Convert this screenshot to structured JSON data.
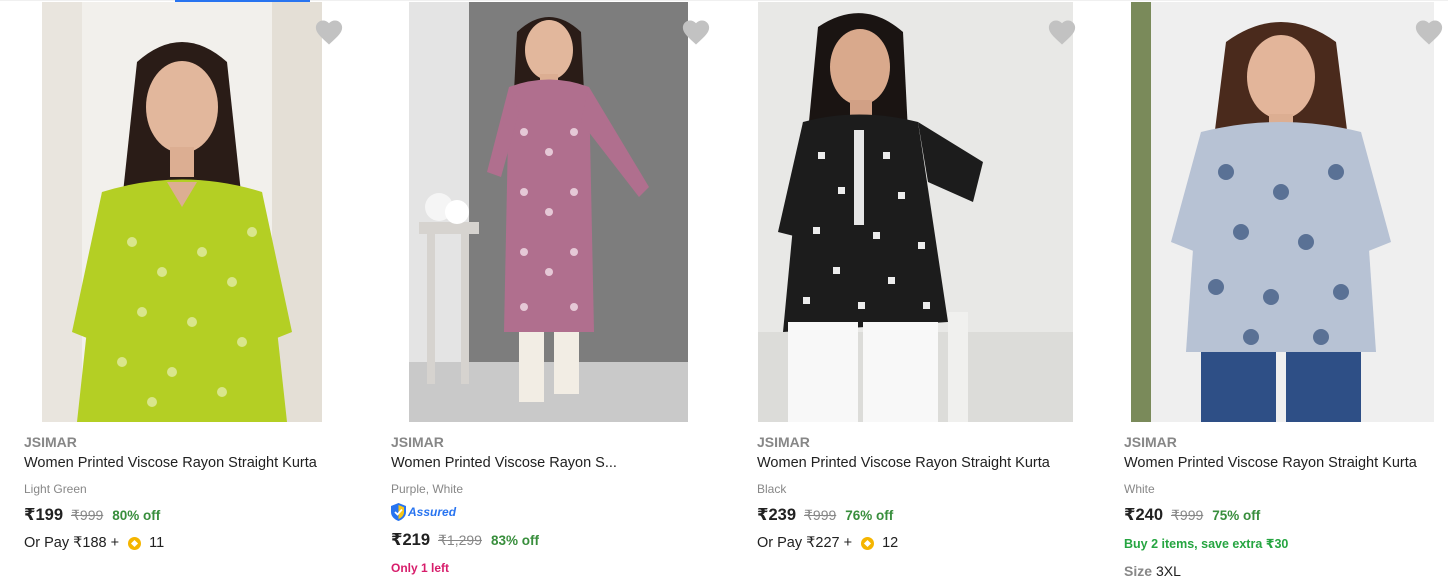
{
  "products": [
    {
      "brand": "JSIMAR",
      "title": "Women Printed Viscose Rayon Straight Kurta",
      "variant": "Light Green",
      "price": "₹199",
      "mrp": "₹999",
      "discount": "80% off",
      "or_pay_text": "Or Pay ₹188 +",
      "coins": "11",
      "image_alt": "Woman in light green printed kurta",
      "colors": {
        "background": "#f2f0ec",
        "garment": "#b4cf24"
      }
    },
    {
      "brand": "JSIMAR",
      "title": "Women Printed Viscose Rayon S...",
      "variant": "Purple, White",
      "assured_label": "Assured",
      "price": "₹219",
      "mrp": "₹1,299",
      "discount": "83% off",
      "stock_text": "Only 1 left",
      "image_alt": "Woman in purple printed straight kurta",
      "colors": {
        "background": "#8a8a8a",
        "garment": "#b06f8e"
      }
    },
    {
      "brand": "JSIMAR",
      "title": "Women Printed Viscose Rayon Straight Kurta",
      "variant": "Black",
      "price": "₹239",
      "mrp": "₹999",
      "discount": "76% off",
      "or_pay_text": "Or Pay ₹227 +",
      "coins": "12",
      "image_alt": "Woman in black printed short kurta",
      "colors": {
        "background": "#e8e8e6",
        "garment": "#1c1c1c"
      }
    },
    {
      "brand": "JSIMAR",
      "title": "Women Printed Viscose Rayon Straight Kurta",
      "variant": "White",
      "price": "₹240",
      "mrp": "₹999",
      "discount": "75% off",
      "offer_text": "Buy 2 items, save extra ₹30",
      "size_label": "Size",
      "size_value": "3XL",
      "image_alt": "Woman in white and blue floral kurta",
      "colors": {
        "background": "#efefef",
        "garment": "#b7c2d4"
      }
    }
  ],
  "icons": {
    "wishlist": "heart-icon",
    "coin": "supercoin-icon",
    "assured": "assured-badge-icon"
  },
  "theme": {
    "accent": "#2874f0",
    "discount_green": "#388e3c",
    "offer_green": "#26a541",
    "stock_pink": "#d71d6b",
    "muted": "#878787"
  }
}
